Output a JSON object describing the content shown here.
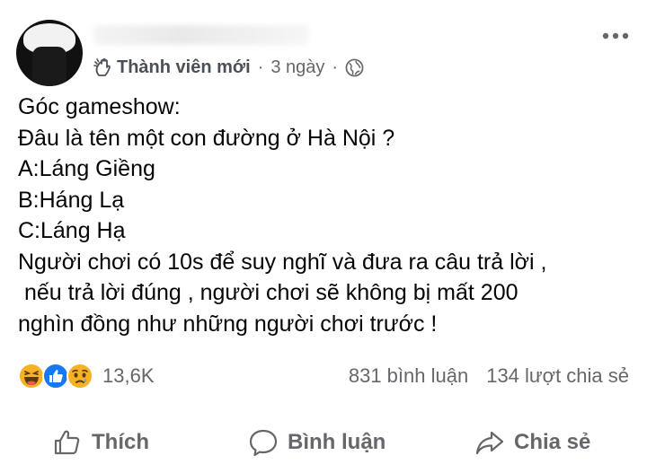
{
  "post": {
    "header": {
      "member_label": "Thành viên mới",
      "separator": "·",
      "time": "3 ngày",
      "separator2": "·",
      "badge_icon": "new-member-badge-icon",
      "privacy_icon": "globe-icon",
      "more_icon": "more-options-icon"
    },
    "lines": [
      "Góc gameshow:",
      "Đâu là tên một con đường ở Hà Nội ?",
      "A:Láng Giềng",
      "B:Háng Lạ",
      "C:Láng Hạ",
      "Người chơi có 10s để suy nghĩ và đưa ra câu trả lời ,",
      " nếu trả lời đúng , người chơi sẽ không bị mất 200",
      "nghìn đồng như những người chơi trước !"
    ],
    "reactions": {
      "icons": [
        "haha-icon",
        "like-icon",
        "sad-icon"
      ],
      "count": "13,6K"
    },
    "stats": {
      "comments": "831 bình luận",
      "shares": "134 lượt chia sẻ"
    },
    "actions": {
      "like": "Thích",
      "comment": "Bình luận",
      "share": "Chia sẻ"
    },
    "colors": {
      "text": "#050505",
      "secondary": "#65676b",
      "like_blue": "#1877f2",
      "haha_yellow": "#f7b125"
    }
  }
}
